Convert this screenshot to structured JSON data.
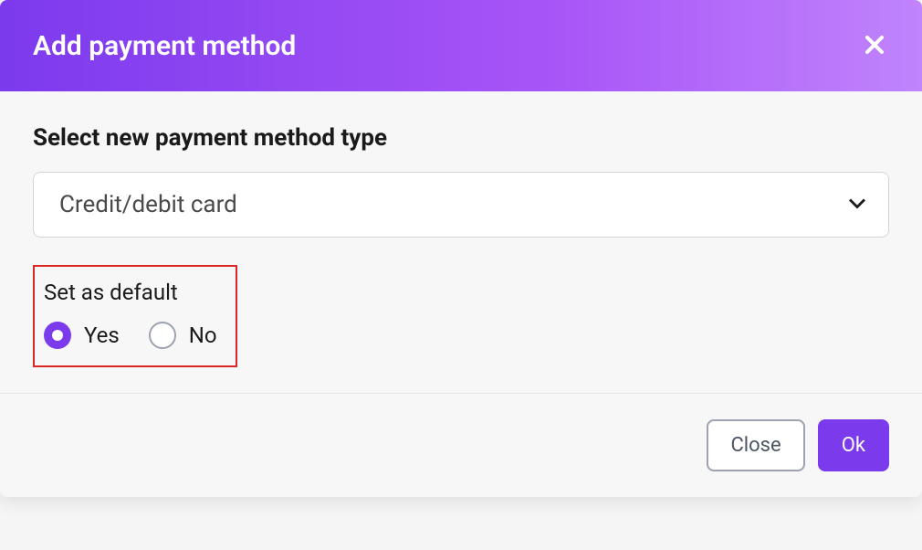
{
  "modal": {
    "title": "Add payment method",
    "section_label": "Select new payment method type",
    "select_value": "Credit/debit card",
    "default_section": {
      "label": "Set as default",
      "options": {
        "yes": "Yes",
        "no": "No"
      },
      "selected": "yes"
    },
    "footer": {
      "close_label": "Close",
      "ok_label": "Ok"
    }
  }
}
